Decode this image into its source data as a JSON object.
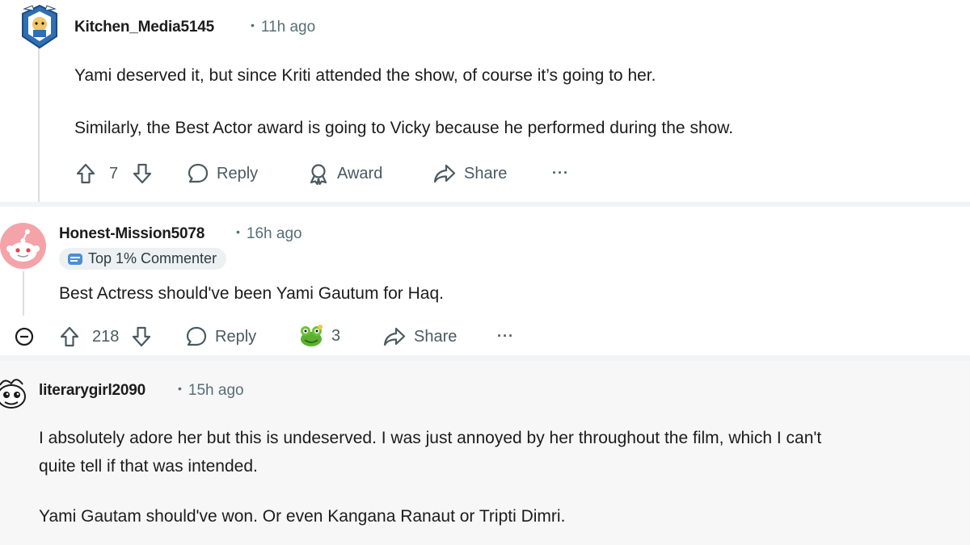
{
  "comments": [
    {
      "username": "Kitchen_Media5145",
      "time": "11h ago",
      "paragraphs": [
        "Yami deserved it, but since Kriti attended the show, of course it’s going to her.",
        "Similarly, the Best Actor award is going to Vicky because he performed during the show."
      ],
      "votes": "7",
      "reply_label": "Reply",
      "award_label": "Award",
      "share_label": "Share",
      "more_label": "···"
    },
    {
      "username": "Honest-Mission5078",
      "time": "16h ago",
      "badge": "Top 1% Commenter",
      "paragraphs": [
        "Best Actress should've been Yami Gautum for Haq."
      ],
      "votes": "218",
      "reply_label": "Reply",
      "award_count": "3",
      "share_label": "Share",
      "more_label": "···"
    },
    {
      "username": "literarygirl2090",
      "time": "15h ago",
      "paragraphs": [
        "I absolutely adore her but this is undeserved. I was just annoyed by her throughout the film, which I can't",
        "quite tell if that was intended.",
        "Yami Gautam should've won. Or even Kangana Ranaut or Tripti Dimri."
      ]
    }
  ],
  "colors": {
    "text": "#1c1c1c",
    "meta": "#576f76",
    "action": "#4a5a60",
    "badge_bg": "#eef1f3",
    "avatar_pink": "#f4a3a8",
    "avatar_blue": "#2f6fb3"
  },
  "icons": [
    "upvote-icon",
    "downvote-icon",
    "comment-icon",
    "award-icon",
    "share-icon",
    "collapse-icon",
    "frog-award-icon",
    "badge-icon"
  ]
}
